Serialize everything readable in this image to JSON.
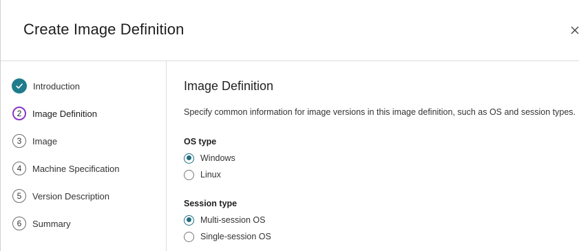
{
  "dialog": {
    "title": "Create Image Definition"
  },
  "steps": [
    {
      "marker": "",
      "label": "Introduction",
      "state": "done"
    },
    {
      "marker": "2",
      "label": "Image Definition",
      "state": "current"
    },
    {
      "marker": "3",
      "label": "Image",
      "state": "pending"
    },
    {
      "marker": "4",
      "label": "Machine Specification",
      "state": "pending"
    },
    {
      "marker": "5",
      "label": "Version Description",
      "state": "pending"
    },
    {
      "marker": "6",
      "label": "Summary",
      "state": "pending"
    }
  ],
  "main": {
    "section_title": "Image Definition",
    "description": "Specify common information for image versions in this image definition, such as OS and session types.",
    "os_type": {
      "label": "OS type",
      "options": [
        {
          "label": "Windows",
          "selected": true
        },
        {
          "label": "Linux",
          "selected": false
        }
      ]
    },
    "session_type": {
      "label": "Session type",
      "options": [
        {
          "label": "Multi-session OS",
          "selected": true
        },
        {
          "label": "Single-session OS",
          "selected": false
        }
      ]
    }
  },
  "colors": {
    "accent_teal": "#1e7b8c",
    "current_step_purple": "#8a35c9"
  },
  "icons": {
    "close": "close-icon",
    "completed_step": "checkmark-icon"
  }
}
